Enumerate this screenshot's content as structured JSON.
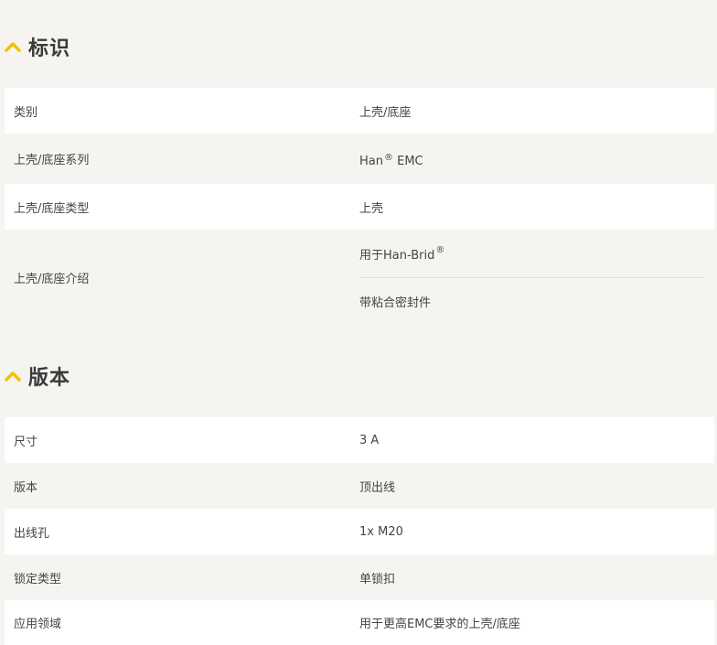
{
  "accent_color": "#f2c200",
  "sections": [
    {
      "title": "标识",
      "icon": "chevron-up-icon",
      "rows": [
        {
          "label": "类别",
          "values": [
            {
              "text": "上壳/底座",
              "sup": ""
            }
          ]
        },
        {
          "label": "上壳/底座系列",
          "values": [
            {
              "text": "Han",
              "sup": "®",
              "after": " EMC"
            }
          ]
        },
        {
          "label": "上壳/底座类型",
          "values": [
            {
              "text": "上壳",
              "sup": ""
            }
          ]
        },
        {
          "label": "上壳/底座介绍",
          "values": [
            {
              "text": "用于Han-Brid",
              "sup": "®"
            },
            {
              "text": "带粘合密封件",
              "sup": ""
            }
          ]
        }
      ]
    },
    {
      "title": "版本",
      "icon": "chevron-up-icon",
      "rows": [
        {
          "label": "尺寸",
          "values": [
            {
              "text": "3 A",
              "sup": ""
            }
          ]
        },
        {
          "label": "版本",
          "values": [
            {
              "text": "顶出线",
              "sup": ""
            }
          ]
        },
        {
          "label": "出线孔",
          "values": [
            {
              "text": "1x M20",
              "sup": ""
            }
          ]
        },
        {
          "label": "锁定类型",
          "values": [
            {
              "text": "单锁扣",
              "sup": ""
            }
          ]
        },
        {
          "label": "应用领域",
          "values": [
            {
              "text": "用于更高EMC要求的上壳/底座",
              "sup": ""
            }
          ]
        }
      ]
    }
  ]
}
